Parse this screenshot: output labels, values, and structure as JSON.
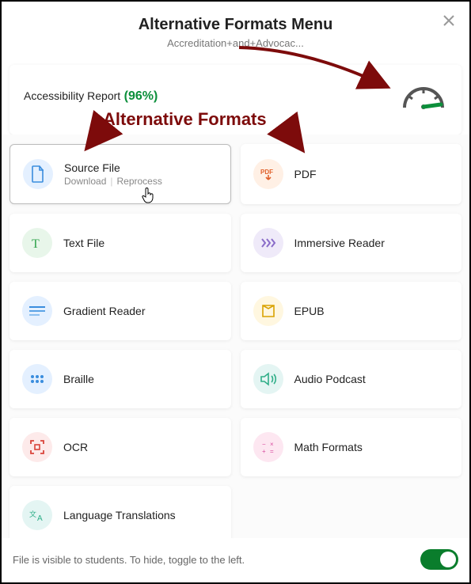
{
  "header": {
    "title": "Alternative Formats Menu",
    "subtitle": "Accreditation+and+Advocac..."
  },
  "report": {
    "label": "Accessibility Report",
    "percent": "(96%)"
  },
  "annotation": {
    "label": "Alternative Formats"
  },
  "cards": {
    "source": {
      "label": "Source File",
      "sub_download": "Download",
      "sub_reprocess": "Reprocess"
    },
    "pdf": {
      "label": "PDF"
    },
    "text": {
      "label": "Text File"
    },
    "immersive": {
      "label": "Immersive Reader"
    },
    "gradient": {
      "label": "Gradient Reader"
    },
    "epub": {
      "label": "EPUB"
    },
    "braille": {
      "label": "Braille"
    },
    "audio": {
      "label": "Audio Podcast"
    },
    "ocr": {
      "label": "OCR"
    },
    "math": {
      "label": "Math Formats"
    },
    "lang": {
      "label": "Language Translations"
    }
  },
  "footer": {
    "text": "File is visible to students. To hide, toggle to the left."
  }
}
